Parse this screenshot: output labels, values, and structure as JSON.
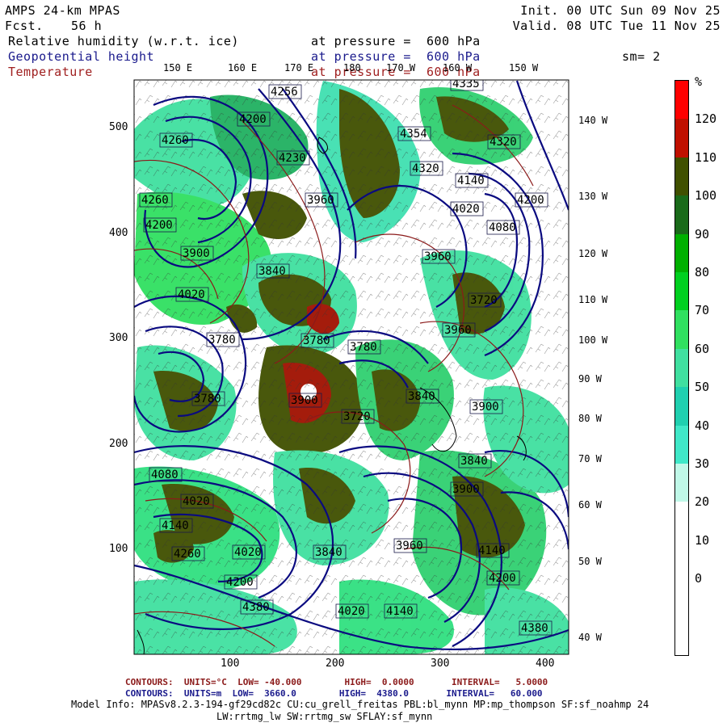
{
  "header": {
    "model": "AMPS 24-km MPAS",
    "fcst_label": "Fcst.",
    "fcst_value": "56 h",
    "init": "Init. 00 UTC Sun 09 Nov 25",
    "valid": "Valid. 08 UTC Tue 11 Nov 25",
    "fields": [
      {
        "name": "Relative humidity (w.r.t. ice)",
        "level": "at pressure =  600 hPa",
        "color": "#000000"
      },
      {
        "name": "Geopotential height",
        "level": "at pressure =  600 hPa",
        "color": "#1a1a8c"
      },
      {
        "name": "Temperature",
        "level": "at pressure =  600 hPa",
        "color": "#a02020"
      }
    ],
    "smoothing": "sm= 2"
  },
  "map": {
    "top_lon_labels": [
      "150 E",
      "160 E",
      "170 E",
      "180",
      "170 W",
      "160 W",
      "150 W"
    ],
    "right_lon_labels": [
      "140 W",
      "130 W",
      "120 W",
      "110 W",
      "100 W",
      "90 W",
      "80 W",
      "70 W",
      "60 W",
      "50 W",
      "40 W"
    ],
    "y_ticks": [
      "500",
      "400",
      "300",
      "200",
      "100"
    ],
    "x_ticks": [
      "100",
      "200",
      "300",
      "400"
    ],
    "height_labels": [
      "4256",
      "4200",
      "4260",
      "4230",
      "4354",
      "4335",
      "4320",
      "4320",
      "4140",
      "4260",
      "4200",
      "3960",
      "4020",
      "4080",
      "4200",
      "3900",
      "3840",
      "3720",
      "3780",
      "4020",
      "3960",
      "3780",
      "3960",
      "3780",
      "3840",
      "3900",
      "3840",
      "3720",
      "4080",
      "4020",
      "4140",
      "3960",
      "4020",
      "3900",
      "4140",
      "4260",
      "4200",
      "4380",
      "4020",
      "4140",
      "4200",
      "4380",
      "3840",
      "3780",
      "3900"
    ],
    "colors": {
      "rh_30": "#e0fff0",
      "rh_40": "#a8f0d8",
      "rh_50": "#40e0b0",
      "rh_60": "#20d080",
      "rh_70": "#10c040",
      "rh_80": "#00b000",
      "rh_90": "#008000",
      "rh_100": "#405000",
      "rh_110": "#a01000",
      "rh_120": "#ff0000",
      "height_contour": "#0a0a80",
      "temp_contour": "#8b1a1a"
    }
  },
  "colorbar": {
    "unit": "%",
    "labels": [
      "120",
      "110",
      "100",
      "90",
      "80",
      "70",
      "60",
      "50",
      "40",
      "30",
      "20",
      "10",
      "0"
    ],
    "colors": [
      "#ff0000",
      "#c01000",
      "#405000",
      "#1a6a1a",
      "#00b000",
      "#00d020",
      "#30e060",
      "#40e0a0",
      "#20d0b0",
      "#40e8c8",
      "#c0f8e8",
      "#ffffff",
      "#ffffff",
      "#ffffff",
      "#ffffff"
    ]
  },
  "footer": {
    "temp_contours": "CONTOURS:  UNITS=°C  LOW= -40.000        HIGH=  0.0000       INTERVAL=   5.0000",
    "height_contours": "CONTOURS:  UNITS=m  LOW=  3660.0        HIGH=  4380.0       INTERVAL=   60.000",
    "model_info_1": "Model Info: MPASv8.2.3-194-gf29cd82c CU:cu_grell_freitas PBL:bl_mynn MP:mp_thompson SF:sf_noahmp 24",
    "model_info_2": "LW:rrtmg_lw SW:rrtmg_sw SFLAY:sf_mynn"
  }
}
